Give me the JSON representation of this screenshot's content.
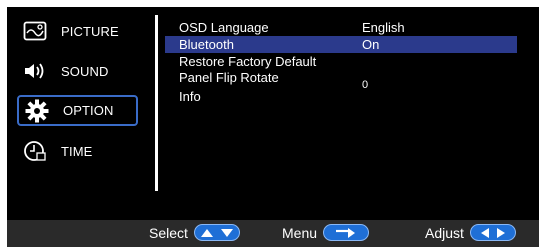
{
  "menu": {
    "items": [
      {
        "label": "PICTURE",
        "icon": "picture-icon"
      },
      {
        "label": "SOUND",
        "icon": "speaker-icon"
      },
      {
        "label": "OPTION",
        "icon": "gear-icon",
        "selected": true
      },
      {
        "label": "TIME",
        "icon": "clock-icon"
      }
    ]
  },
  "options": {
    "rows": [
      {
        "label": "OSD Language",
        "value": "English"
      },
      {
        "label": "Bluetooth",
        "value": "On",
        "highlighted": true
      },
      {
        "label": "Restore Factory Default",
        "value": ""
      },
      {
        "label": "Panel Flip Rotate",
        "value": "0"
      },
      {
        "label": "Info",
        "value": ""
      }
    ]
  },
  "bottombar": {
    "select_label": "Select",
    "menu_label": "Menu",
    "adjust_label": "Adjust"
  },
  "colors": {
    "background": "#000000",
    "highlight": "#2b3a8c",
    "selected_border": "#3a6cc8",
    "pill": "#1f6fd6",
    "bottombar": "#2a2a2a"
  }
}
